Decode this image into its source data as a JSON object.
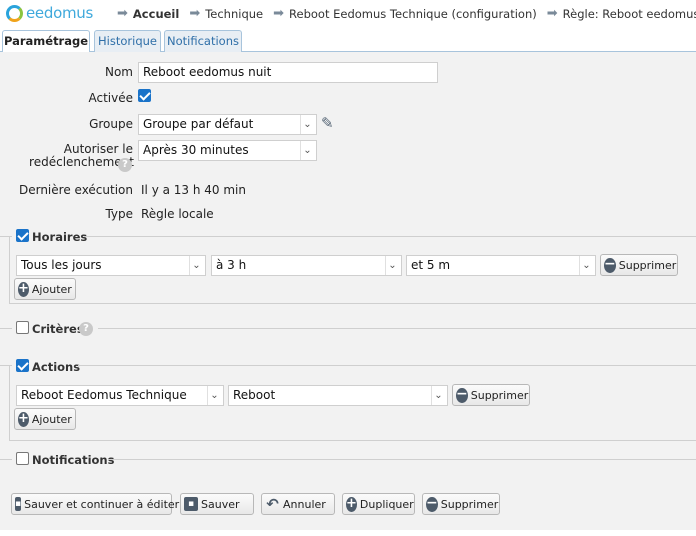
{
  "brand": {
    "logo_text": "eedomus"
  },
  "breadcrumb": [
    {
      "label": "Accueil",
      "bold": true
    },
    {
      "label": "Technique"
    },
    {
      "label": "Reboot Eedomus Technique (configuration)"
    },
    {
      "label": "Règle: Reboot eedomus nuit"
    }
  ],
  "tabs": [
    {
      "label": "Paramétrage",
      "active": true
    },
    {
      "label": "Historique"
    },
    {
      "label": "Notifications"
    }
  ],
  "form": {
    "nom_label": "Nom",
    "nom_value": "Reboot eedomus nuit",
    "activee_label": "Activée",
    "activee_checked": true,
    "groupe_label": "Groupe",
    "groupe_value": "Groupe par défaut",
    "autoriser_label_line1": "Autoriser le",
    "autoriser_label_line2": "redéclenchement",
    "autoriser_value": "Après 30 minutes",
    "derniere_label": "Dernière exécution",
    "derniere_value": "Il y a 13 h 40 min",
    "type_label": "Type",
    "type_value": "Règle locale"
  },
  "horaires": {
    "title": "Horaires",
    "checked": true,
    "day": "Tous les jours",
    "hour": "à 3 h",
    "minute": "et 5 m",
    "delete_label": "Supprimer",
    "add_label": "Ajouter"
  },
  "criteres": {
    "title": "Critères",
    "checked": false
  },
  "actions": {
    "title": "Actions",
    "checked": true,
    "device": "Reboot Eedomus Technique",
    "action": "Reboot",
    "delete_label": "Supprimer",
    "add_label": "Ajouter"
  },
  "notifications": {
    "title": "Notifications",
    "checked": false
  },
  "footer_buttons": {
    "save_continue": "Sauver et continuer à éditer",
    "save": "Sauver",
    "cancel": "Annuler",
    "duplicate": "Dupliquer",
    "delete": "Supprimer"
  },
  "icons": {
    "arrow": "arrow-right-icon",
    "help": "question-icon",
    "edit": "pencil-icon",
    "add": "plus-circle-icon",
    "remove": "minus-circle-icon",
    "save": "floppy-icon",
    "undo": "undo-icon"
  }
}
